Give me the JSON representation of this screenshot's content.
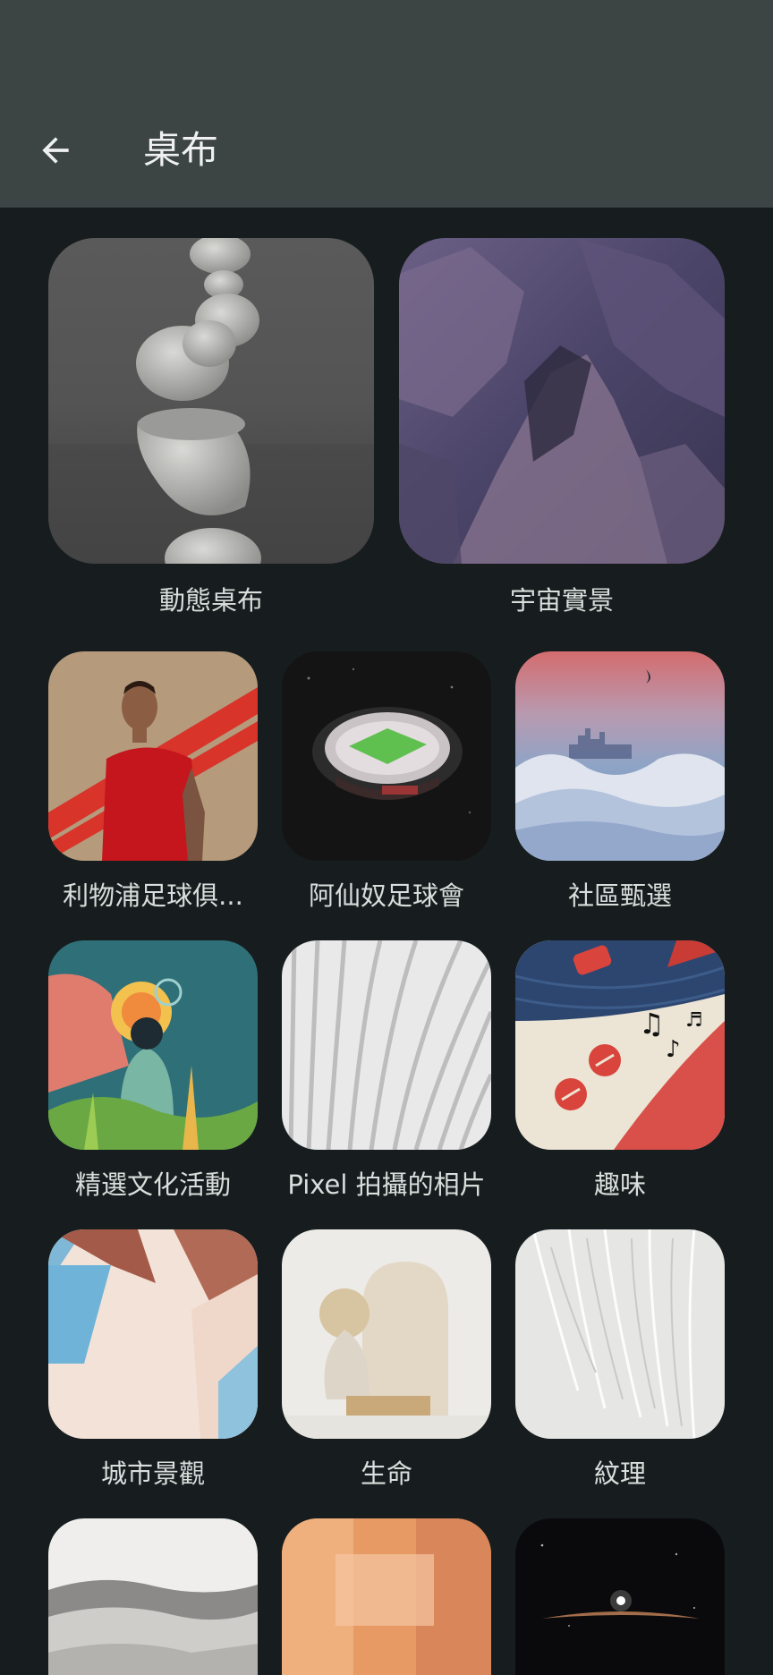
{
  "header": {
    "title": "桌布",
    "back_icon": "arrow-back-icon"
  },
  "categories": [
    {
      "label": "動態桌布",
      "icon": "stacked-stones-image"
    },
    {
      "label": "宇宙實景",
      "icon": "canyon-cliff-image"
    },
    {
      "label": "利物浦足球俱...",
      "icon": "liverpool-player-image"
    },
    {
      "label": "阿仙奴足球會",
      "icon": "stadium-night-image"
    },
    {
      "label": "社區甄選",
      "icon": "fog-skyline-image"
    },
    {
      "label": "精選文化活動",
      "icon": "illustration-person-image"
    },
    {
      "label": "Pixel 拍攝的相片",
      "icon": "white-architecture-image"
    },
    {
      "label": "趣味",
      "icon": "record-player-image"
    },
    {
      "label": "城市景觀",
      "icon": "pastel-building-image"
    },
    {
      "label": "生命",
      "icon": "stone-arch-still-life-image"
    },
    {
      "label": "紋理",
      "icon": "white-feather-image"
    },
    {
      "label": "",
      "icon": "sand-dunes-image"
    },
    {
      "label": "",
      "icon": "orange-abstract-image"
    },
    {
      "label": "",
      "icon": "space-horizon-image"
    }
  ],
  "colors": {
    "app_bar": "#3d4444",
    "background": "#171d1e",
    "label_text": "#d9dedc"
  }
}
